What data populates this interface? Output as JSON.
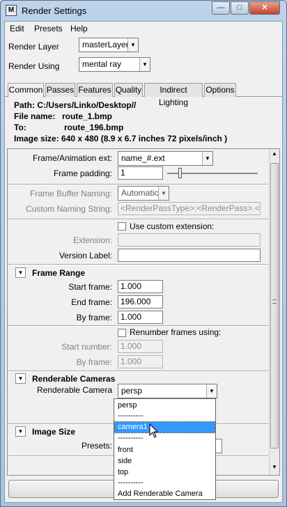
{
  "window": {
    "title": "Render Settings",
    "app_icon": "maya-icon"
  },
  "menubar": {
    "edit": "Edit",
    "presets": "Presets",
    "help": "Help"
  },
  "render_layer": {
    "label": "Render Layer",
    "value": "masterLayer"
  },
  "render_using": {
    "label": "Render Using",
    "value": "mental ray"
  },
  "tabs": [
    "Common",
    "Passes",
    "Features",
    "Quality",
    "Indirect Lighting",
    "Options"
  ],
  "info": {
    "path": "Path: C:/Users/Linko/Desktop//",
    "file_name_label": "File name:",
    "file_name": "route_1.bmp",
    "to_label": "To:",
    "to": "route_196.bmp",
    "image_size": "Image size: 640 x 480 (8.9 x 6.7 inches 72 pixels/inch )"
  },
  "file_output": {
    "frame_ext_label": "Frame/Animation ext:",
    "frame_ext_value": "name_#.ext",
    "frame_padding_label": "Frame padding:",
    "frame_padding_value": "1",
    "frame_buffer_label": "Frame Buffer Naming:",
    "frame_buffer_value": "Automatic",
    "custom_naming_label": "Custom Naming String:",
    "custom_naming_value": "<RenderPassType>:<RenderPass>.<Came",
    "use_custom_ext": "Use custom extension:",
    "extension_label": "Extension:",
    "version_label": "Version Label:"
  },
  "frame_range": {
    "title": "Frame Range",
    "start_label": "Start frame:",
    "start_value": "1.000",
    "end_label": "End frame:",
    "end_value": "196.000",
    "by_label": "By frame:",
    "by_value": "1.000",
    "renumber": "Renumber frames using:",
    "start_number_label": "Start number:",
    "start_number_value": "1.000",
    "by_frame2_label": "By frame:",
    "by_frame2_value": "1.000"
  },
  "renderable_cameras": {
    "title": "Renderable Cameras",
    "camera_label": "Renderable Camera",
    "camera_value": "persp"
  },
  "image_size": {
    "title": "Image Size",
    "presets_label": "Presets:"
  },
  "camera_dropdown": {
    "items": [
      "persp",
      "----------",
      "camera1",
      "----------",
      "front",
      "side",
      "top",
      "----------",
      "Add Renderable Camera"
    ],
    "selected_index": 2
  }
}
